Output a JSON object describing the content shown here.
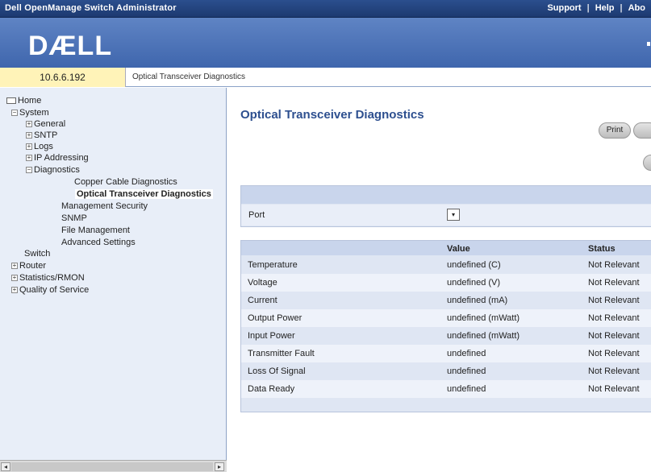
{
  "titlebar": {
    "app": "Dell OpenManage Switch Administrator",
    "support": "Support",
    "help": "Help",
    "about": "Abo",
    "sep": "|"
  },
  "brand": {
    "logo": "DÆLL"
  },
  "infobar": {
    "ip": "10.6.6.192",
    "crumb": "Optical Transceiver Diagnostics"
  },
  "tree": {
    "home": "Home",
    "system": "System",
    "general": "General",
    "sntp": "SNTP",
    "logs": "Logs",
    "ip_addressing": "IP Addressing",
    "diagnostics": "Diagnostics",
    "copper": "Copper Cable Diagnostics",
    "optical": "Optical Transceiver Diagnostics",
    "mgmt_security": "Management Security",
    "snmp": "SNMP",
    "file_mgmt": "File Management",
    "advanced": "Advanced Settings",
    "switch": "Switch",
    "router": "Router",
    "statistics": "Statistics/RMON",
    "qos": "Quality of Service"
  },
  "main": {
    "title": "Optical Transceiver Diagnostics",
    "print_button": "Print",
    "port_label": "Port",
    "columns": {
      "value": "Value",
      "status": "Status"
    },
    "rows": [
      {
        "name": "Temperature",
        "value": "undefined (C)",
        "status": "Not Relevant"
      },
      {
        "name": "Voltage",
        "value": "undefined (V)",
        "status": "Not Relevant"
      },
      {
        "name": "Current",
        "value": "undefined (mA)",
        "status": "Not Relevant"
      },
      {
        "name": "Output Power",
        "value": "undefined (mWatt)",
        "status": "Not Relevant"
      },
      {
        "name": "Input Power",
        "value": "undefined (mWatt)",
        "status": "Not Relevant"
      },
      {
        "name": "Transmitter Fault",
        "value": "undefined",
        "status": "Not Relevant"
      },
      {
        "name": "Loss Of Signal",
        "value": "undefined",
        "status": "Not Relevant"
      },
      {
        "name": "Data Ready",
        "value": "undefined",
        "status": "Not Relevant"
      }
    ]
  }
}
